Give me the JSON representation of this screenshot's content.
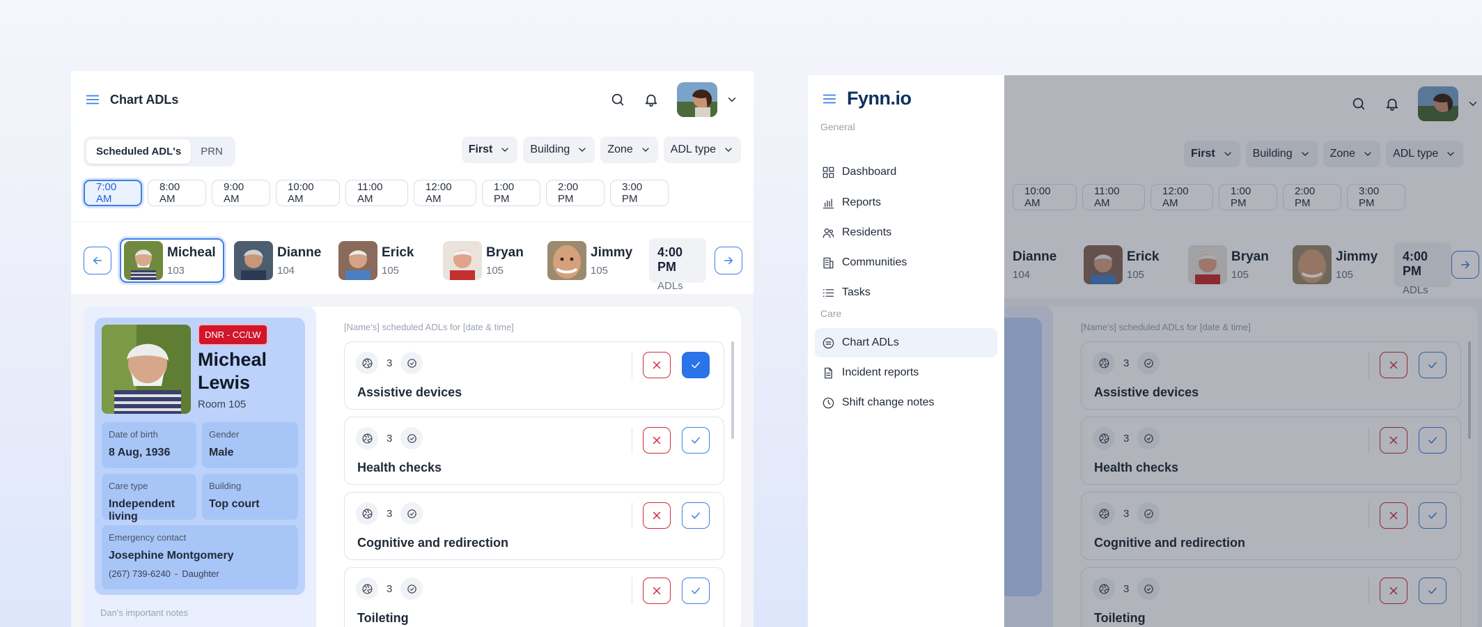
{
  "screen1": {
    "title": "Chart ADLs",
    "tabs": [
      "Scheduled ADL's",
      "PRN"
    ],
    "filters": [
      "First",
      "Building",
      "Zone",
      "ADL type"
    ],
    "times": [
      "7:00 AM",
      "8:00 AM",
      "9:00 AM",
      "10:00 AM",
      "11:00 AM",
      "12:00 AM",
      "1:00 PM",
      "2:00 PM",
      "3:00 PM"
    ],
    "residents": [
      {
        "name": "Micheal",
        "room": "103"
      },
      {
        "name": "Dianne",
        "room": "104"
      },
      {
        "name": "Erick",
        "room": "105"
      },
      {
        "name": "Bryan",
        "room": "105"
      },
      {
        "name": "Jimmy",
        "room": "105"
      }
    ],
    "next_time": {
      "time": "4:00 PM",
      "label": "ADLs"
    },
    "profile": {
      "badge": "DNR - CC/LW",
      "first_name": "Micheal",
      "last_name": "Lewis",
      "room": "Room 105",
      "dob_label": "Date of birth",
      "dob": "8 Aug, 1936",
      "gender_label": "Gender",
      "gender": "Male",
      "care_label": "Care type",
      "care": "Independent living",
      "building_label": "Building",
      "building": "Top court",
      "emergency_label": "Emergency contact",
      "emergency_name": "Josephine Montgomery",
      "emergency_phone": "(267) 739-6240",
      "emergency_sep": "-",
      "emergency_rel": "Daughter",
      "notes_label": "Dan's important notes"
    },
    "adl_heading": "[Name's] scheduled ADLs for [date & time]",
    "adls": [
      {
        "count": "3",
        "name": "Assistive devices",
        "checked": true
      },
      {
        "count": "3",
        "name": "Health checks",
        "checked": false
      },
      {
        "count": "3",
        "name": "Cognitive and redirection",
        "checked": false
      },
      {
        "count": "3",
        "name": "Toileting",
        "checked": false
      }
    ]
  },
  "screen2": {
    "logo": "Fynn.io",
    "section_general": "General",
    "section_care": "Care",
    "nav_general": [
      {
        "label": "Dashboard",
        "icon": "grid-icon"
      },
      {
        "label": "Reports",
        "icon": "bar-chart-icon"
      },
      {
        "label": "Residents",
        "icon": "users-icon"
      },
      {
        "label": "Communities",
        "icon": "building-icon"
      },
      {
        "label": "Tasks",
        "icon": "list-icon"
      }
    ],
    "nav_care": [
      {
        "label": "Chart ADLs",
        "icon": "chart-adl-icon",
        "active": true
      },
      {
        "label": "Incident reports",
        "icon": "document-icon"
      },
      {
        "label": "Shift change notes",
        "icon": "clock-icon"
      }
    ],
    "filters": [
      "First",
      "Building",
      "Zone",
      "ADL type"
    ],
    "times": [
      "10:00 AM",
      "11:00 AM",
      "12:00 AM",
      "1:00 PM",
      "2:00 PM",
      "3:00 PM"
    ],
    "residents": [
      {
        "name": "Dianne",
        "room": "104"
      },
      {
        "name": "Erick",
        "room": "105"
      },
      {
        "name": "Bryan",
        "room": "105"
      },
      {
        "name": "Jimmy",
        "room": "105"
      }
    ],
    "next_time": {
      "time": "4:00 PM",
      "label": "ADLs"
    },
    "adl_heading": "[Name's] scheduled ADLs for [date & time]",
    "adls": [
      {
        "count": "3",
        "name": "Assistive devices"
      },
      {
        "count": "3",
        "name": "Health checks"
      },
      {
        "count": "3",
        "name": "Cognitive and redirection"
      },
      {
        "count": "3",
        "name": "Toileting"
      }
    ]
  },
  "colors": {
    "accent": "#2a73e8",
    "danger": "#cf2b3b",
    "badge": "#d1152a",
    "profile_bg": "#bcd2fa"
  }
}
